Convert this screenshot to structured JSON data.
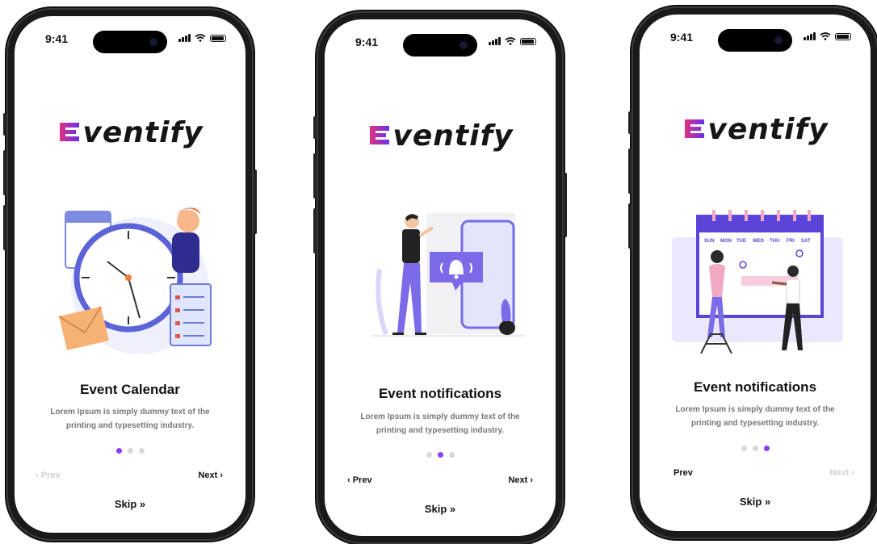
{
  "brand": {
    "name": "ventify",
    "accent": "#8a3ff3",
    "logo_gradient": [
      "#e0317f",
      "#6a2ff0"
    ]
  },
  "screens": [
    {
      "status": {
        "time": "9:41"
      },
      "title": "Event Calendar",
      "description": "Lorem Ipsum is simply dummy text of the printing and typesetting industry.",
      "active_dot": 1,
      "prev": {
        "label": "‹ Prev",
        "enabled": false
      },
      "next": {
        "label": "Next ›",
        "enabled": true
      },
      "skip": {
        "label": "Skip »"
      },
      "illustration": "clock-calendar-illustration"
    },
    {
      "status": {
        "time": "9:41"
      },
      "title": "Event notifications",
      "description": "Lorem Ipsum is simply dummy text of the printing and typesetting industry.",
      "active_dot": 2,
      "prev": {
        "label": "‹ Prev",
        "enabled": true
      },
      "next": {
        "label": "Next ›",
        "enabled": true
      },
      "skip": {
        "label": "Skip »"
      },
      "illustration": "phone-bell-illustration"
    },
    {
      "status": {
        "time": "9:41"
      },
      "title": "Event notifications",
      "description": "Lorem Ipsum is simply dummy text of the printing and typesetting industry.",
      "active_dot": 3,
      "prev": {
        "label": "Prev",
        "enabled": true
      },
      "next": {
        "label": "Next ›",
        "enabled": false
      },
      "skip": {
        "label": "Skip »"
      },
      "illustration": "team-calendar-illustration",
      "calendar_days": [
        "SUN",
        "MON",
        "TUE",
        "WED",
        "THU",
        "FRI",
        "SAT"
      ]
    }
  ]
}
